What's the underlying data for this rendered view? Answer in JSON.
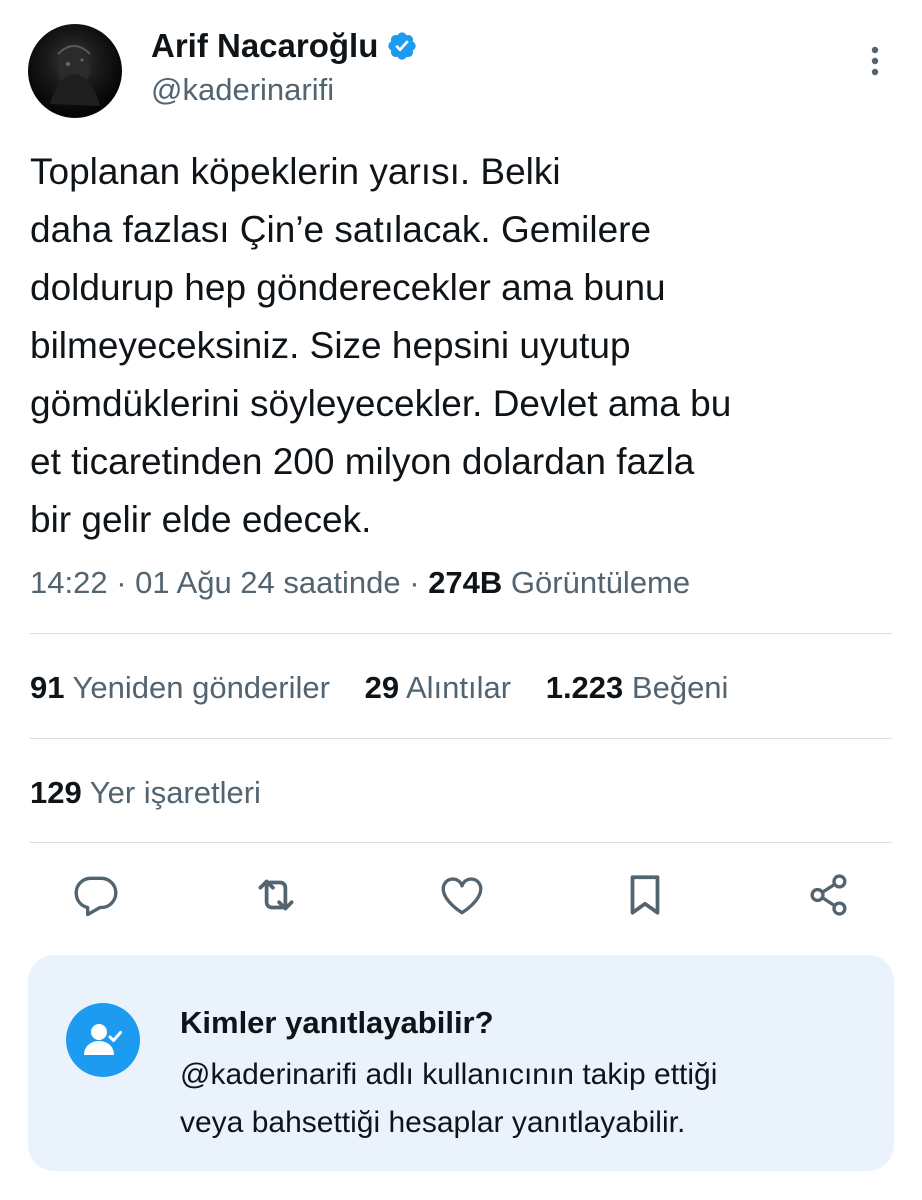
{
  "author": {
    "name": "Arif Nacaroğlu",
    "handle": "@kaderinarifi",
    "verified_icon": "verified-badge-icon",
    "verified_color": "#1d9bf0"
  },
  "tweet": {
    "lines": [
      "Toplanan köpeklerin yarısı. Belki",
      "daha fazlası Çin’e satılacak. Gemilere",
      "doldurup hep gönderecekler ama bunu",
      "bilmeyeceksiniz. Size hepsini uyutup",
      "gömdüklerini söyleyecekler. Devlet ama bu",
      "et ticaretinden 200 milyon dolardan fazla",
      "bir gelir elde edecek."
    ]
  },
  "meta": {
    "time": "14:22",
    "separator": "·",
    "date": "01 Ağu 24 saatinde",
    "views_count": "274B",
    "views_label": "Görüntüleme"
  },
  "stats": {
    "reposts_count": "91",
    "reposts_label": "Yeniden gönderiler",
    "quotes_count": "29",
    "quotes_label": "Alıntılar",
    "likes_count": "1.223",
    "likes_label": "Beğeni",
    "bookmarks_count": "129",
    "bookmarks_label": "Yer işaretleri"
  },
  "actions": [
    {
      "icon": "reply-icon"
    },
    {
      "icon": "repost-icon"
    },
    {
      "icon": "like-icon"
    },
    {
      "icon": "bookmark-icon"
    },
    {
      "icon": "share-icon"
    }
  ],
  "reply_restriction": {
    "title": "Kimler yanıtlayabilir?",
    "line1": "@kaderinarifi adlı kullanıcının takip ettiği",
    "line2": "veya bahsettiği hesaplar yanıtlayabilir.",
    "icon": "user-check-icon"
  },
  "colors": {
    "text": "#0f1419",
    "secondary": "#536471",
    "accent": "#1d9bf0",
    "info_bg": "#eaf3fc"
  }
}
